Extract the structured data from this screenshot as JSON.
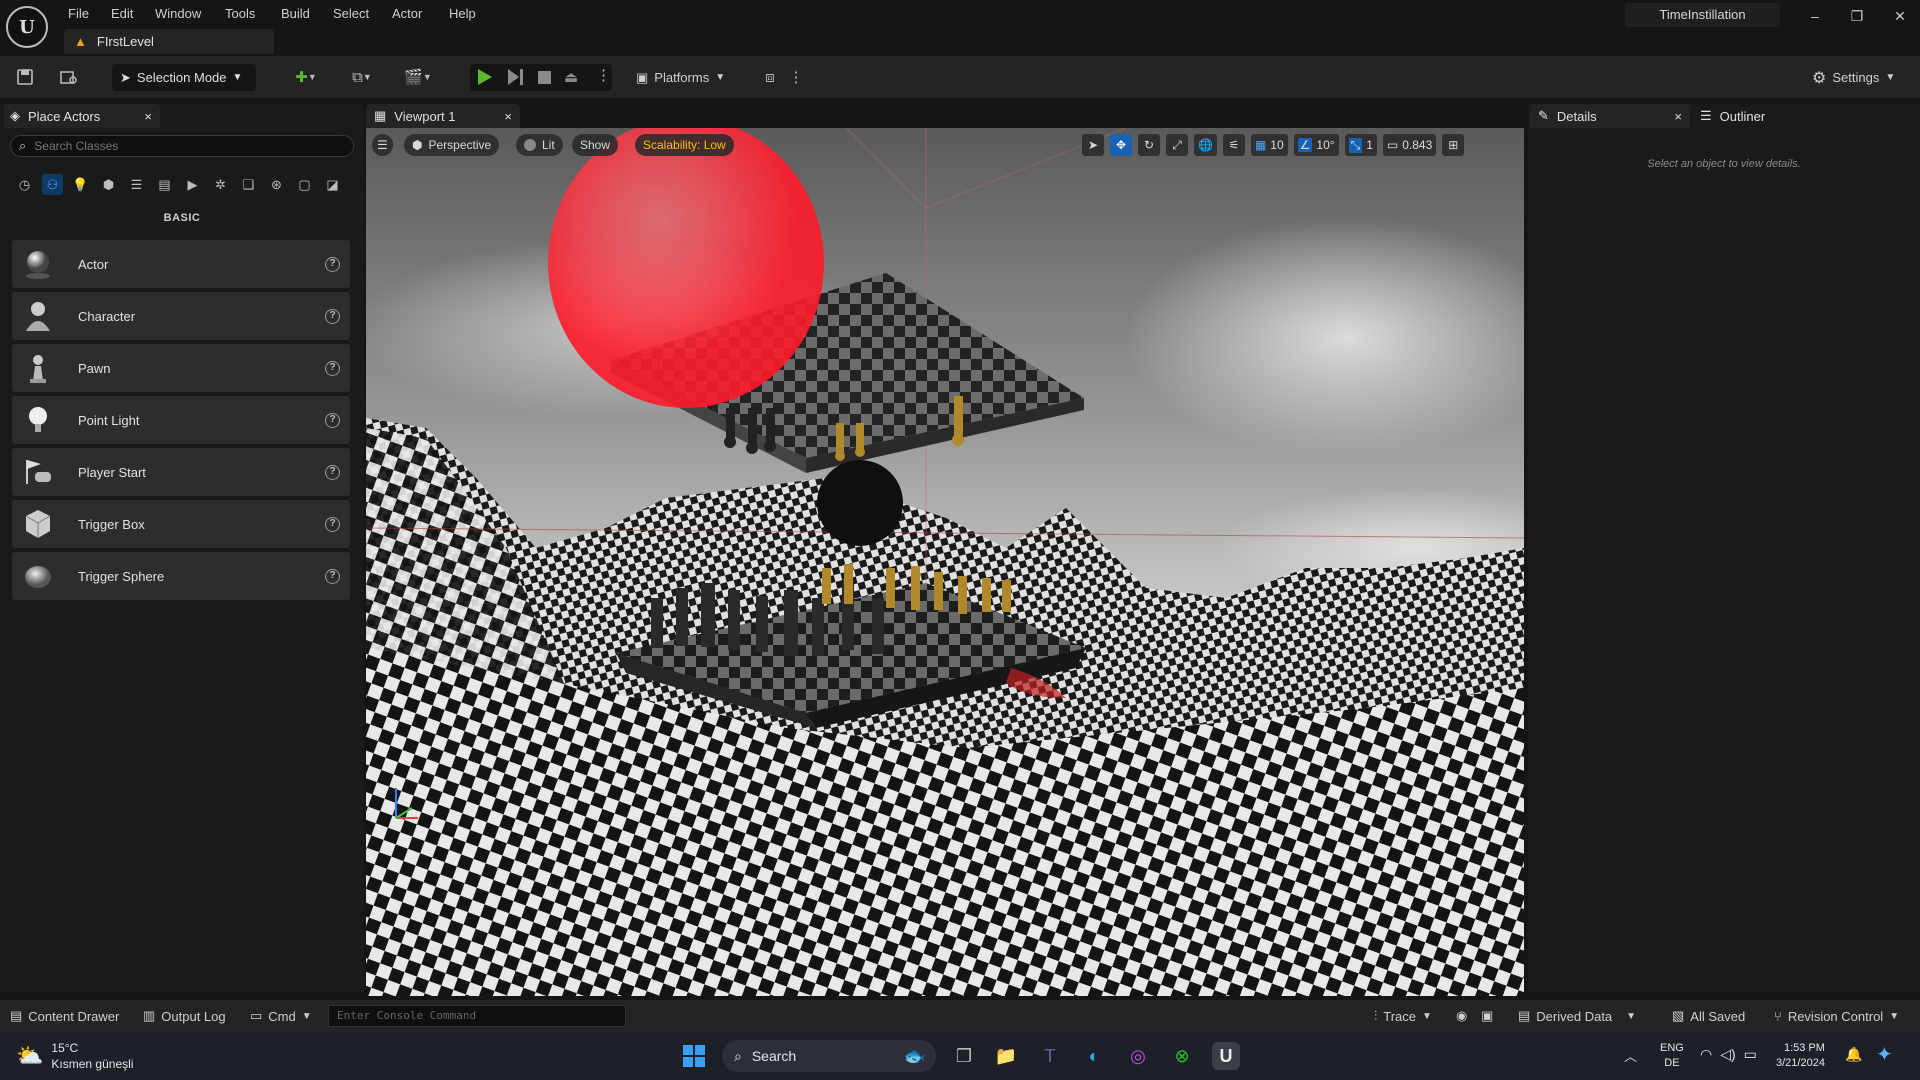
{
  "menubar": {
    "items": [
      "File",
      "Edit",
      "Window",
      "Tools",
      "Build",
      "Select",
      "Actor",
      "Help"
    ]
  },
  "level_tab": {
    "label": "FIrstLevel"
  },
  "project_name": "TimeInstillation",
  "toolbar": {
    "selection_mode": "Selection Mode",
    "platforms": "Platforms",
    "settings": "Settings"
  },
  "place_actors": {
    "tab_label": "Place Actors",
    "close": "×",
    "search_placeholder": "Search Classes",
    "section": "BASIC",
    "items": [
      {
        "label": "Actor",
        "icon": "sphere-actor-icon"
      },
      {
        "label": "Character",
        "icon": "character-icon"
      },
      {
        "label": "Pawn",
        "icon": "pawn-icon"
      },
      {
        "label": "Point Light",
        "icon": "light-bulb-icon"
      },
      {
        "label": "Player Start",
        "icon": "player-start-icon"
      },
      {
        "label": "Trigger Box",
        "icon": "trigger-box-icon"
      },
      {
        "label": "Trigger Sphere",
        "icon": "trigger-sphere-icon"
      }
    ]
  },
  "viewport": {
    "tab_label": "Viewport 1",
    "close": "×",
    "perspective": "Perspective",
    "lit": "Lit",
    "show": "Show",
    "scalability": "Scalability: Low",
    "grid_snap": "10",
    "rotation_snap": "10°",
    "scale_snap": "1",
    "camera_speed": "0.843"
  },
  "details": {
    "tab_label": "Details",
    "close": "×",
    "empty_message": "Select an object to view details."
  },
  "outliner": {
    "tab_label": "Outliner"
  },
  "statusbar": {
    "content_drawer": "Content Drawer",
    "output_log": "Output Log",
    "cmd": "Cmd",
    "console_placeholder": "Enter Console Command",
    "trace": "Trace",
    "derived_data": "Derived Data",
    "all_saved": "All Saved",
    "revision_control": "Revision Control"
  },
  "taskbar": {
    "weather_temp": "15°C",
    "weather_desc": "Kısmen güneşli",
    "search": "Search",
    "lang_top": "ENG",
    "lang_bottom": "DE",
    "time": "1:53 PM",
    "date": "3/21/2024"
  },
  "colors": {
    "accent_blue": "#1463b5",
    "play_green": "#5cb82a",
    "scalability_yellow": "#f0c400",
    "red_sphere": "#ff2a3a"
  }
}
